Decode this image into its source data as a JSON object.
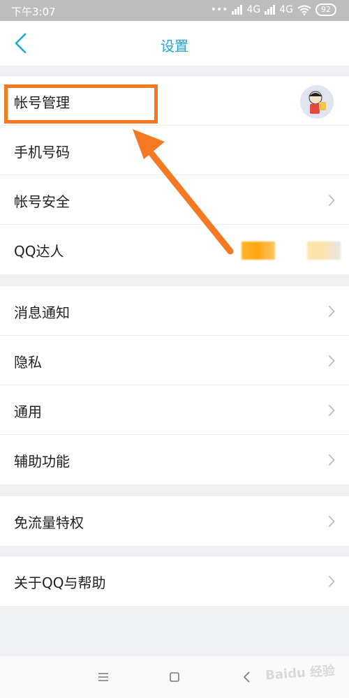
{
  "status_bar": {
    "time": "下午3:07",
    "net1": "4G",
    "net2": "4G",
    "battery": "92"
  },
  "header": {
    "title": "设置"
  },
  "groups": [
    {
      "items": [
        {
          "label": "帐号管理"
        },
        {
          "label": "手机号码"
        },
        {
          "label": "帐号安全"
        },
        {
          "label": "QQ达人"
        }
      ]
    },
    {
      "items": [
        {
          "label": "消息通知"
        },
        {
          "label": "隐私"
        },
        {
          "label": "通用"
        },
        {
          "label": "辅助功能"
        }
      ]
    },
    {
      "items": [
        {
          "label": "免流量特权"
        }
      ]
    },
    {
      "items": [
        {
          "label": "关于QQ与帮助"
        }
      ]
    }
  ],
  "colors": {
    "accent": "#22a6d8",
    "highlight": "#f57822",
    "background": "#eef0f4"
  },
  "watermark": "Baidu 经验",
  "icons": {
    "back": "back-chevron-icon",
    "chevron": "chevron-right-icon",
    "menu": "menu-icon",
    "home": "home-icon",
    "nav_back": "nav-back-icon"
  }
}
